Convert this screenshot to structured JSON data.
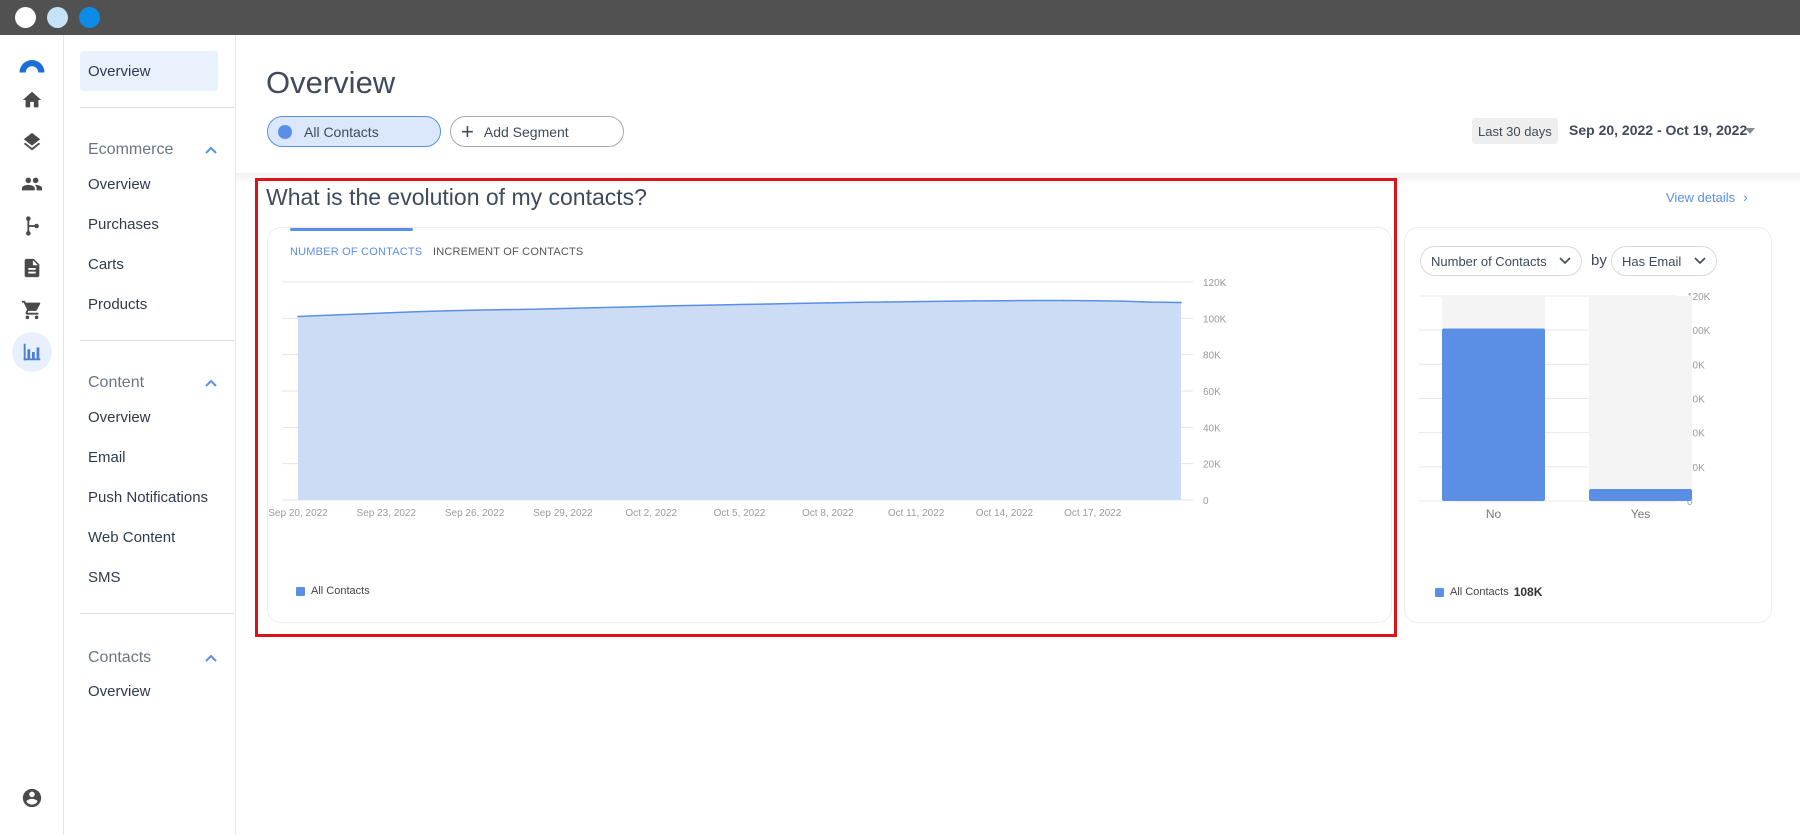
{
  "sidebar": {
    "items": [
      {
        "label": "Overview"
      },
      {
        "section": "Ecommerce"
      },
      {
        "label": "Overview"
      },
      {
        "label": "Purchases"
      },
      {
        "label": "Carts"
      },
      {
        "label": "Products"
      },
      {
        "section": "Content"
      },
      {
        "label": "Overview"
      },
      {
        "label": "Email"
      },
      {
        "label": "Push Notifications"
      },
      {
        "label": "Web Content"
      },
      {
        "label": "SMS"
      },
      {
        "section": "Contacts"
      },
      {
        "label": "Overview"
      }
    ]
  },
  "header": {
    "title": "Overview",
    "segment_label": "All Contacts",
    "add_segment_label": "Add Segment",
    "range_label": "Last 30 days",
    "date_range": "Sep 20, 2022 - Oct 19, 2022"
  },
  "section": {
    "question": "What is the evolution of my contacts?",
    "view_details": "View details",
    "tabs": [
      "NUMBER OF CONTACTS",
      "INCREMENT OF CONTACTS"
    ],
    "legend": "All Contacts"
  },
  "breakdown": {
    "metric_select": "Number of Contacts",
    "by_label": "by",
    "dimension_select": "Has Email",
    "legend": "All Contacts",
    "legend_total": "108K"
  },
  "colors": {
    "accent": "#5b8fe5",
    "area_fill": "#cddcf5",
    "highlight": "#d9141b"
  },
  "chart_data": [
    {
      "type": "area",
      "series": [
        {
          "name": "All Contacts",
          "values": [
            101000,
            101700,
            102300,
            103000,
            103600,
            104100,
            104500,
            104800,
            105000,
            105400,
            105800,
            106200,
            106600,
            107000,
            107300,
            107600,
            107900,
            108200,
            108500,
            108800,
            109000,
            109200,
            109400,
            109600,
            109700,
            109800,
            109800,
            109700,
            109500,
            108900,
            108700
          ]
        }
      ],
      "x_start_day": "Sep 20, 2022",
      "x_tick_labels": [
        "Sep 20, 2022",
        "Sep 23, 2022",
        "Sep 26, 2022",
        "Sep 29, 2022",
        "Oct 2, 2022",
        "Oct 5, 2022",
        "Oct 8, 2022",
        "Oct 11, 2022",
        "Oct 14, 2022",
        "Oct 17, 2022"
      ],
      "y_tick_labels": [
        "0",
        "20K",
        "40K",
        "60K",
        "80K",
        "100K",
        "120K"
      ],
      "ylim": [
        0,
        120000
      ],
      "grid": true,
      "legend_position": "bottom-left"
    },
    {
      "type": "bar",
      "categories": [
        "No",
        "Yes"
      ],
      "values": [
        101000,
        7000
      ],
      "y_tick_labels": [
        "0",
        "20K",
        "40K",
        "60K",
        "80K",
        "100K",
        "120K"
      ],
      "ylim": [
        0,
        120000
      ],
      "grid": true,
      "legend_position": "bottom-left"
    }
  ]
}
